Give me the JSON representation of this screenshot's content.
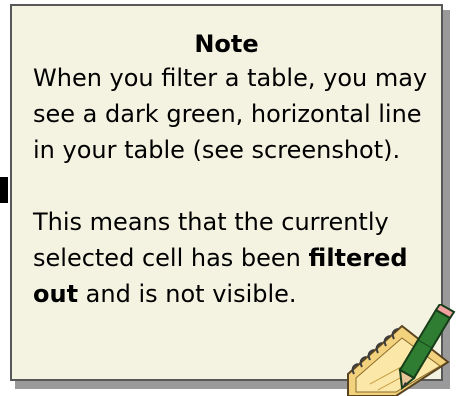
{
  "note": {
    "title": "Note",
    "paragraph1": "When you filter a table, you may see a dark green, horizontal line in your table (see screenshot).",
    "paragraph2": {
      "part1": "This means that the currently selected cell has been ",
      "bold": "filtered out",
      "part2": " and is not visible."
    }
  },
  "icons": {
    "decoration": "pencil-notepad-icon"
  },
  "colors": {
    "background": "#f4f3e2",
    "border": "#585858",
    "pencil": "#2f7d32",
    "notepad": "#f5d98a"
  }
}
